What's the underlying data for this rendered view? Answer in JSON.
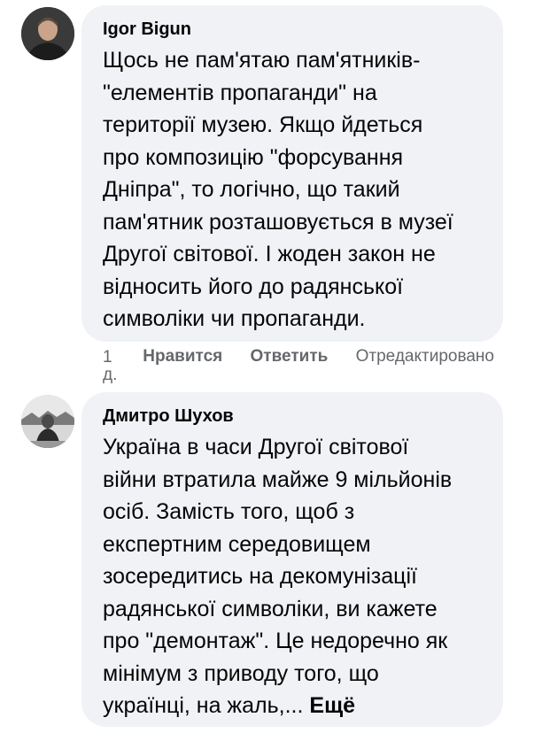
{
  "comments": [
    {
      "author": "Igor Bigun",
      "text": "Щось не пам'ятаю пам'ятників-\n\"елементів пропаганди\" на\nтериторії музею. Якщо йдеться\nпро композицію \"форсування\nДніпра\", то логічно, що такий\nпам'ятник розташовується в музеї\nДругої світової. І жоден закон не\nвідносить його до радянської\nсимволіки чи пропаганди.",
      "time": "1\nд.",
      "like_label": "Нравится",
      "reply_label": "Ответить",
      "edited_label": "Отредактировано"
    },
    {
      "author": "Дмитро Шухов",
      "text": "Україна в часи Другої світової\nвійни втратила майже 9 мільйонів\nосіб. Замість того, щоб з\nекспертним середовищем\nзосередитись на декомунізації\nрадянської символіки, ви кажете\nпро \"демонтаж\". Це недоречно як\nмінімум з приводу того, що\nукраїнці, на жаль,... ",
      "more_label": "Ещё"
    }
  ]
}
